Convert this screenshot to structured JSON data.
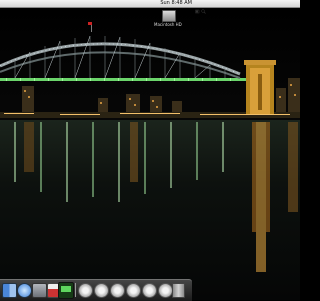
{
  "menubar": {
    "clock": "Sun 8:48 AM",
    "status_icons": [
      "battery-icon",
      "wifi-icon",
      "volume-icon",
      "spotlight-icon"
    ]
  },
  "desktop": {
    "wallpaper": "Sydney Harbour Bridge at night",
    "icons": [
      {
        "label": "Macintosh HD",
        "icon": "hard-drive-icon"
      }
    ]
  },
  "dock": {
    "items": [
      {
        "name": "finder-icon"
      },
      {
        "name": "safari-icon"
      },
      {
        "name": "mail-icon"
      },
      {
        "name": "ical-icon"
      },
      {
        "name": "dashboard-icon"
      },
      {
        "name": "disk-volume-icon"
      },
      {
        "name": "disk-volume-icon"
      },
      {
        "name": "disk-volume-icon"
      },
      {
        "name": "disk-volume-icon"
      },
      {
        "name": "disk-volume-icon"
      },
      {
        "name": "disk-volume-icon"
      },
      {
        "name": "trash-icon"
      }
    ]
  },
  "colors": {
    "sky": "#000000",
    "water": "#0b0e0d",
    "bridge_lights": "#7fe07a",
    "city_lights": "#f0a640"
  }
}
